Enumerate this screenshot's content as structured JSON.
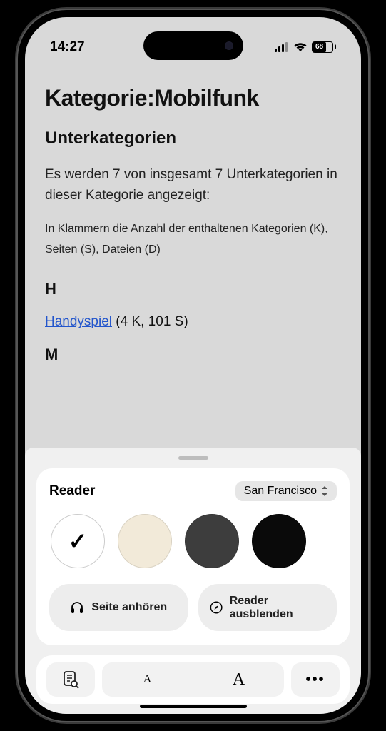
{
  "status": {
    "time": "14:27",
    "battery": "68"
  },
  "page": {
    "title": "Kategorie:Mobilfunk",
    "subheading": "Unterkategorien",
    "intro": "Es werden 7 von insgesamt 7 Unterkategorien in dieser Kategorie angezeigt:",
    "legend": "In Klammern die Anzahl der enthaltenen Kategorien (K), Seiten (S), Dateien (D)",
    "sections": {
      "H": {
        "letter": "H",
        "link": "Handyspiel",
        "meta": " (4 K, 101 S)"
      },
      "M": {
        "letter": "M"
      }
    }
  },
  "reader": {
    "panel_title": "Reader",
    "font_name": "San Francisco",
    "listen": "Seite anhören",
    "hide": "Reader ausblenden"
  },
  "toolbar": {
    "small_a": "A",
    "big_a": "A",
    "more": "•••"
  }
}
